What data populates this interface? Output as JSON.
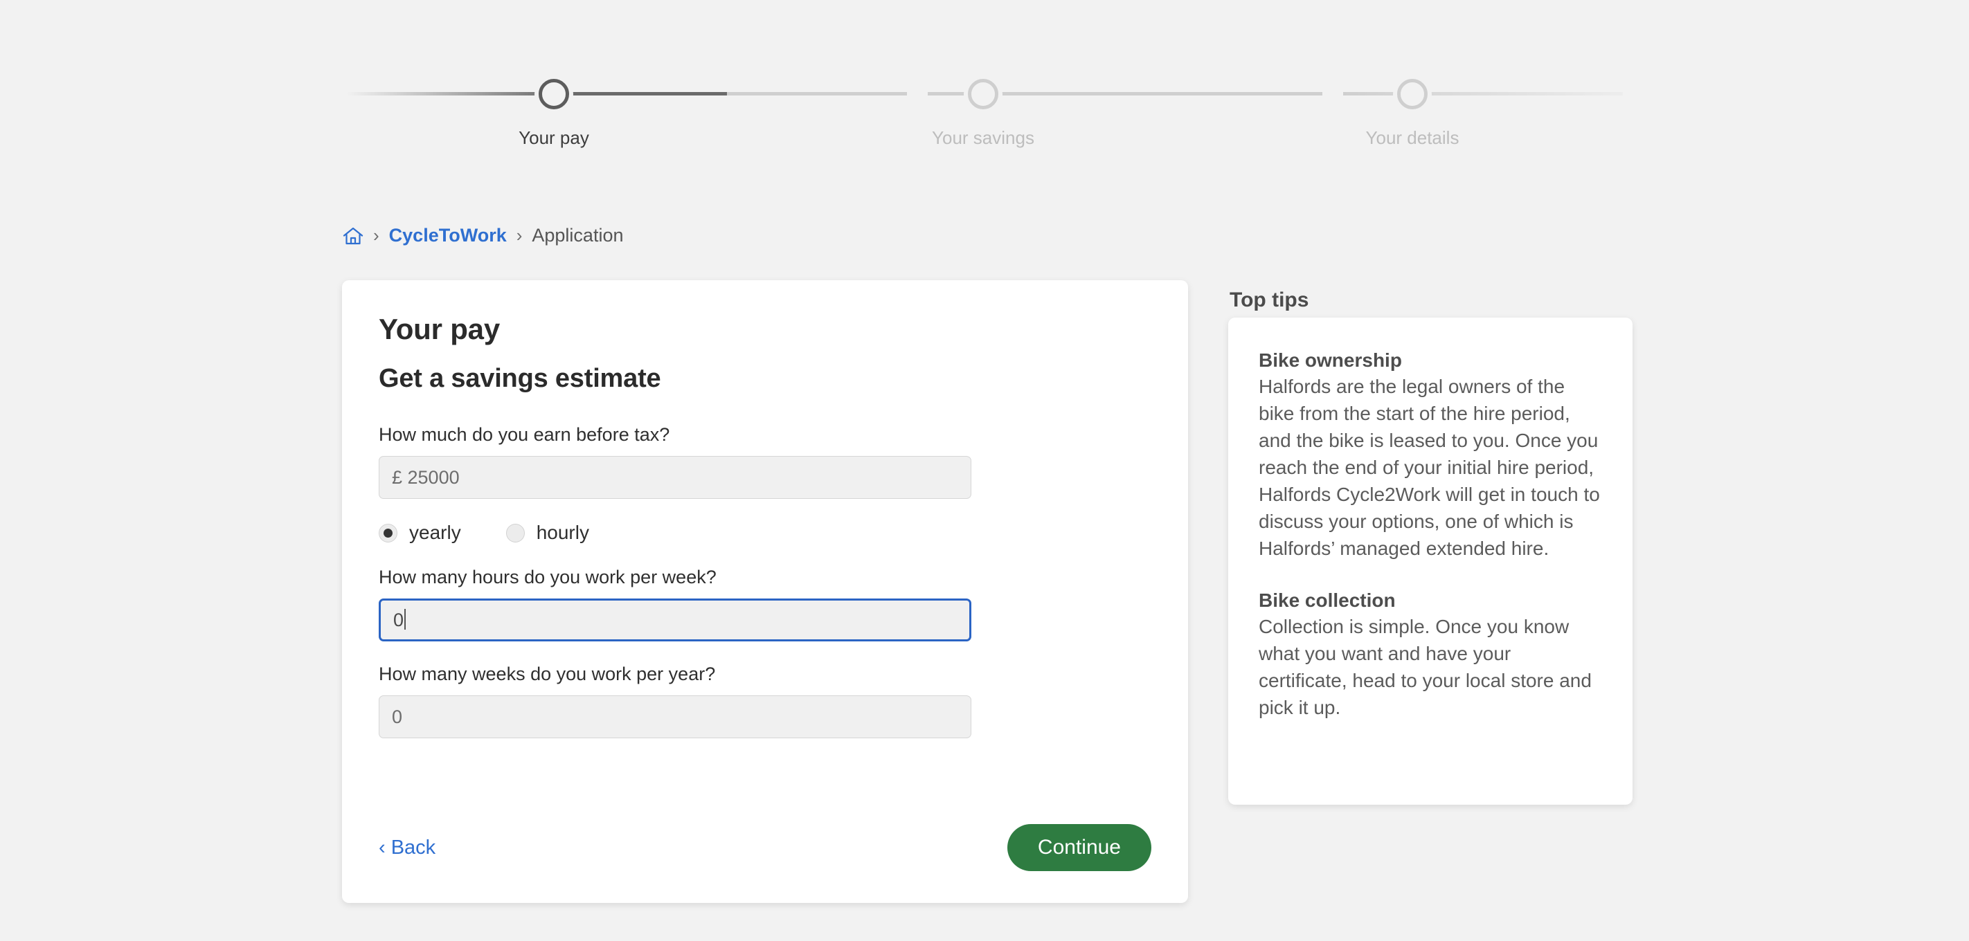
{
  "stepper": {
    "steps": [
      {
        "label": "Your pay",
        "state": "current"
      },
      {
        "label": "Your savings",
        "state": "upcoming"
      },
      {
        "label": "Your details",
        "state": "upcoming"
      }
    ]
  },
  "breadcrumb": {
    "home_icon": "home-icon",
    "separator": "›",
    "link": "CycleToWork",
    "current": "Application"
  },
  "main": {
    "title": "Your pay",
    "subtitle": "Get a savings estimate",
    "fields": {
      "earnings": {
        "label": "How much do you earn before tax?",
        "value": "£ 25000",
        "placeholder": "£ 25000"
      },
      "hours": {
        "label": "How many hours do you work per week?",
        "value": "0",
        "placeholder": "0"
      },
      "weeks": {
        "label": "How many weeks do you work per year?",
        "value": "0",
        "placeholder": "0"
      }
    },
    "pay_frequency": {
      "selected": "yearly",
      "options": [
        {
          "label": "yearly",
          "checked": true
        },
        {
          "label": "hourly",
          "checked": false
        }
      ]
    },
    "actions": {
      "back_label": "‹ Back",
      "continue_label": "Continue"
    }
  },
  "tips": {
    "heading": "Top tips",
    "items": [
      {
        "title": "Bike ownership",
        "body": "Halfords are the legal owners of the bike from the start of the hire period, and the bike is leased to you. Once you reach the end of your initial hire period, Halfords Cycle2Work will get in touch to discuss your options, one of which is Halfords’ managed extended hire."
      },
      {
        "title": "Bike collection",
        "body": "Collection is simple. Once you know what you want and have your certificate, head to your local store and pick it up."
      }
    ]
  },
  "colors": {
    "page_background": "#f2f2f2",
    "accent_blue": "#2f6fd0",
    "focus_blue": "#2b64c4",
    "continue_green": "#2e7c41",
    "step_active": "#5d5d5d",
    "step_inactive": "#cfcfcf"
  }
}
